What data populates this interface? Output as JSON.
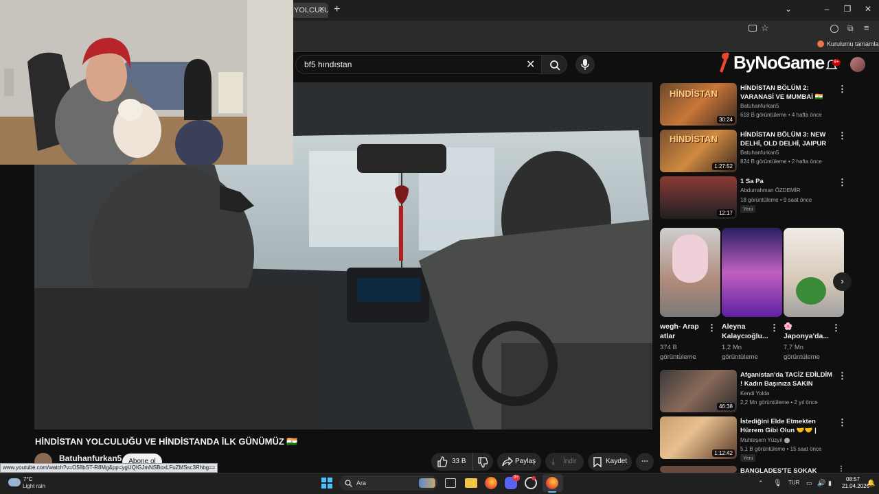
{
  "browser": {
    "tab_title": "YOLCULUĞ",
    "bookmark_text": "Kurulumu tamamla"
  },
  "youtube": {
    "search_value": "bf5 hındıstan",
    "logo_text": "ByNoGame",
    "notification_count": "9+"
  },
  "video": {
    "title": "HİNDİSTAN YOLCULUĞU VE HİNDİSTANDA İLK GÜNÜMÜZ 🇮🇳",
    "channel": "Batuhanfurkan5",
    "subscribe": "Abone ol",
    "likes": "33 B",
    "share": "Paylaş",
    "download": "İndir",
    "save": "Kaydet",
    "status_url": "www.youtube.com/watch?v=O58bST-R8Mg&pp=ygUQIGJmNSBoxLFuZMSsc3Rhbg=="
  },
  "sidebar": {
    "videos_top": [
      {
        "title": "HİNDİSTAN BÖLÜM 2: VARANASİ VE MUMBAİ 🇮🇳",
        "channel": "Batuhanfurkan5",
        "meta": "618 B görüntüleme • 4 hafta önce",
        "duration": "30:24",
        "badge": ""
      },
      {
        "title": "HİNDİSTAN BÖLÜM 3: NEW DELHİ, OLD DELHİ, JAIPUR 🇮🇳",
        "channel": "Batuhanfurkan5",
        "meta": "824 B görüntüleme • 2 hafta önce",
        "duration": "1:27:52",
        "badge": ""
      },
      {
        "title": "1 Sa Pa",
        "channel": "Abdurrahman ÖZDEMİR",
        "meta": "18 görüntüleme • 9 saat önce",
        "duration": "12:17",
        "badge": "Yeni"
      }
    ],
    "shorts": [
      {
        "title": "wegh- Arap atlar",
        "views": "374 B görüntüleme"
      },
      {
        "title": "Aleyna Kalaycıoğlu...",
        "views": "1,2 Mn görüntüleme"
      },
      {
        "title": "🌸 Japonya'da...",
        "views": "7,7 Mn görüntüleme"
      }
    ],
    "videos_bottom": [
      {
        "title": "Afganistan'da TACİZ EDİLDİM ! Kadın Başınıza SAKIN DIŞARI ...",
        "channel": "Kendi Yolda",
        "meta": "2,2 Mn görüntüleme • 2 yıl önce",
        "duration": "46:38",
        "badge": ""
      },
      {
        "title": "İstediğini Elde Etmekten Hürrem Gibi Olun 🤝🤝 | Muhteşem ...",
        "channel": "Muhteşem Yüzyıl",
        "meta": "5,1 B görüntüleme • 15 saat önce",
        "duration": "1:12:42",
        "badge": "Yeni"
      },
      {
        "title": "BANGLADEŞ'TE SOKAK YEMEĞİ",
        "channel": "",
        "meta": "",
        "duration": "",
        "badge": ""
      }
    ]
  },
  "taskbar": {
    "temp": "7°C",
    "weather": "Light rain",
    "search_placeholder": "Ara",
    "lang": "TUR",
    "time": "08:57",
    "date": "21.04.2026",
    "discord_badge": "9+"
  }
}
